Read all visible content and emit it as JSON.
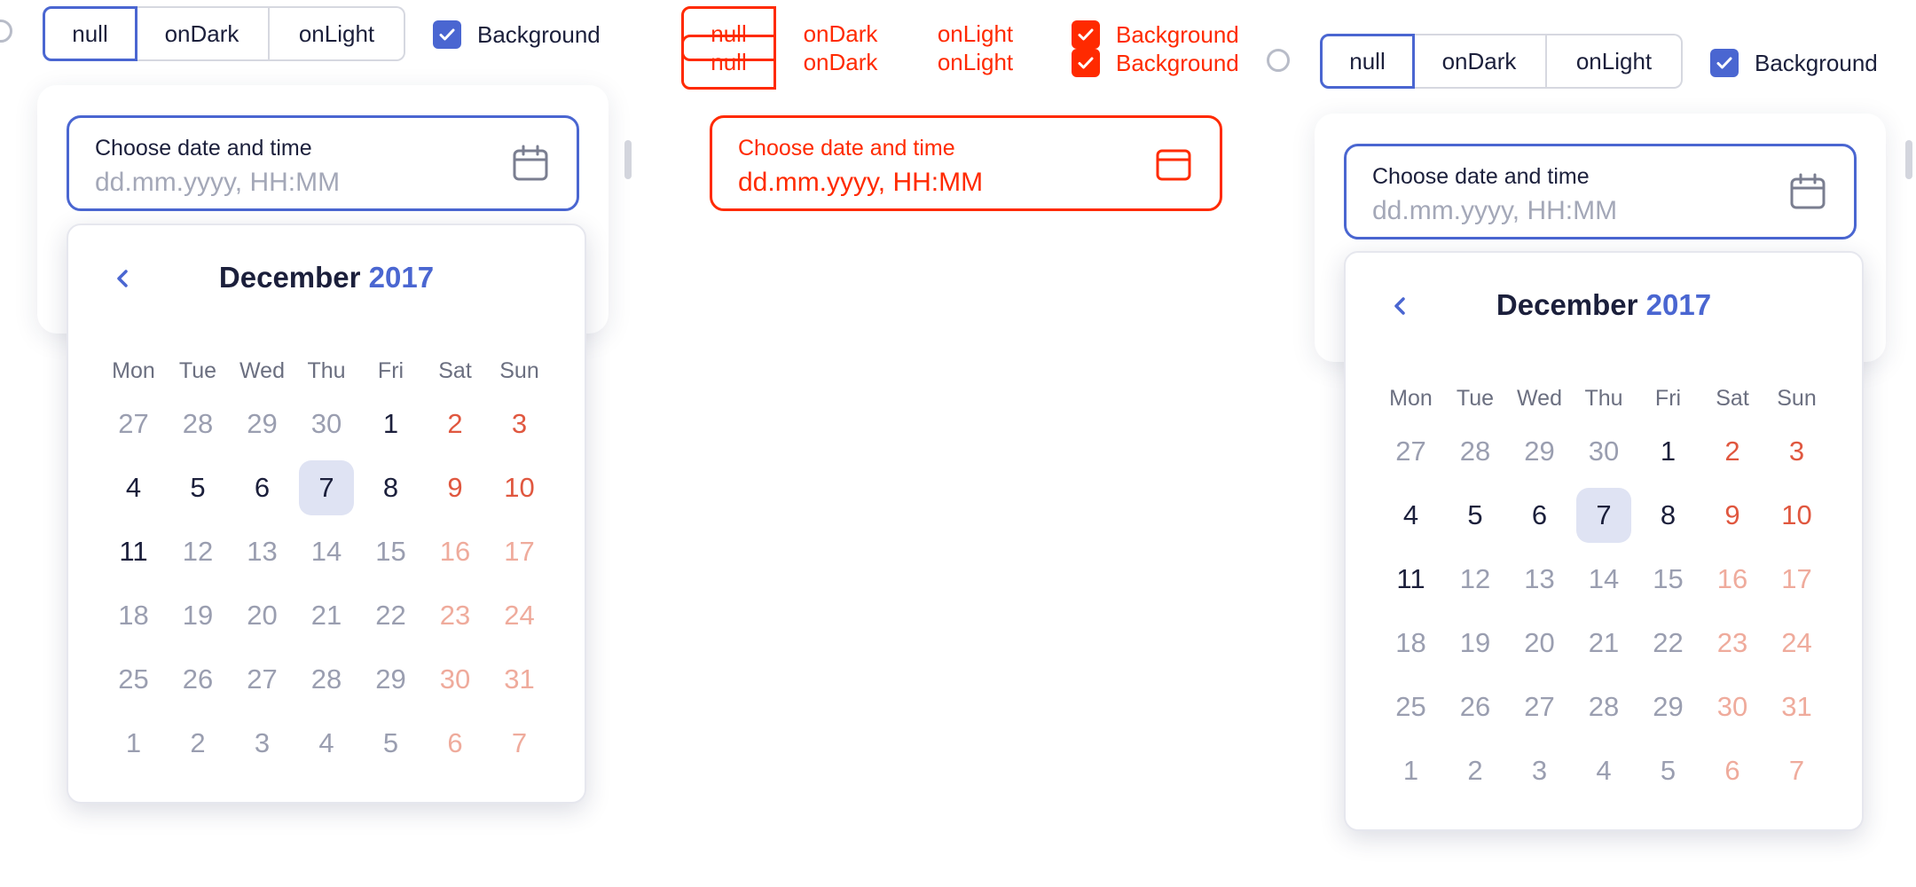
{
  "tabs": [
    "null",
    "onDark",
    "onLight"
  ],
  "background_label": "Background",
  "input": {
    "label": "Choose date and time",
    "placeholder": "dd.mm.yyyy, HH:MM"
  },
  "calendar": {
    "month": "December",
    "year": "2017",
    "weekdays": [
      "Mon",
      "Tue",
      "Wed",
      "Thu",
      "Fri",
      "Sat",
      "Sun"
    ],
    "weeks": [
      [
        "27",
        "28",
        "29",
        "30",
        "1",
        "2",
        "3"
      ],
      [
        "4",
        "5",
        "6",
        "7",
        "8",
        "9",
        "10"
      ],
      [
        "11",
        "12",
        "13",
        "14",
        "15",
        "16",
        "17"
      ],
      [
        "18",
        "19",
        "20",
        "21",
        "22",
        "23",
        "24"
      ],
      [
        "25",
        "26",
        "27",
        "28",
        "29",
        "30",
        "31"
      ],
      [
        "1",
        "2",
        "3",
        "4",
        "5",
        "6",
        "7"
      ]
    ],
    "selected": "7"
  },
  "colors": {
    "accent": "#4a66d1",
    "text": "#1b1f3b",
    "weekend": "#e0573f",
    "muted": "#9a9eb0",
    "debug_red": "#ff2a00"
  }
}
